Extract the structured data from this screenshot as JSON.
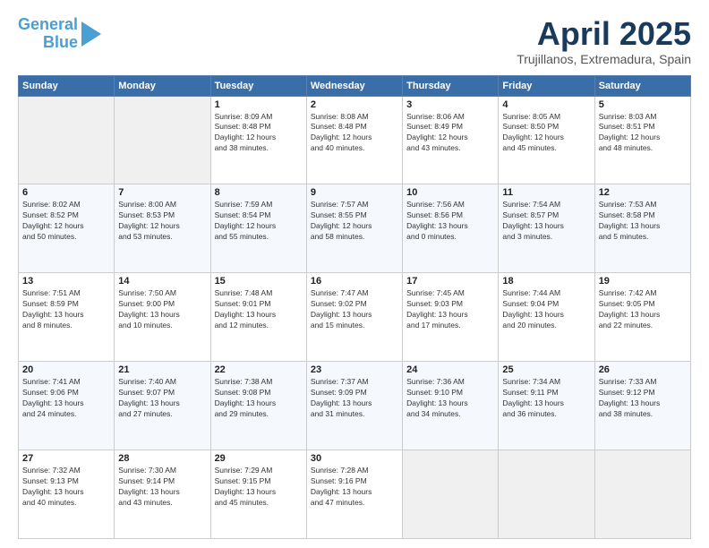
{
  "logo": {
    "line1": "General",
    "line2": "Blue"
  },
  "title": "April 2025",
  "subtitle": "Trujillanos, Extremadura, Spain",
  "weekdays": [
    "Sunday",
    "Monday",
    "Tuesday",
    "Wednesday",
    "Thursday",
    "Friday",
    "Saturday"
  ],
  "weeks": [
    [
      {
        "day": "",
        "info": ""
      },
      {
        "day": "",
        "info": ""
      },
      {
        "day": "1",
        "info": "Sunrise: 8:09 AM\nSunset: 8:48 PM\nDaylight: 12 hours\nand 38 minutes."
      },
      {
        "day": "2",
        "info": "Sunrise: 8:08 AM\nSunset: 8:48 PM\nDaylight: 12 hours\nand 40 minutes."
      },
      {
        "day": "3",
        "info": "Sunrise: 8:06 AM\nSunset: 8:49 PM\nDaylight: 12 hours\nand 43 minutes."
      },
      {
        "day": "4",
        "info": "Sunrise: 8:05 AM\nSunset: 8:50 PM\nDaylight: 12 hours\nand 45 minutes."
      },
      {
        "day": "5",
        "info": "Sunrise: 8:03 AM\nSunset: 8:51 PM\nDaylight: 12 hours\nand 48 minutes."
      }
    ],
    [
      {
        "day": "6",
        "info": "Sunrise: 8:02 AM\nSunset: 8:52 PM\nDaylight: 12 hours\nand 50 minutes."
      },
      {
        "day": "7",
        "info": "Sunrise: 8:00 AM\nSunset: 8:53 PM\nDaylight: 12 hours\nand 53 minutes."
      },
      {
        "day": "8",
        "info": "Sunrise: 7:59 AM\nSunset: 8:54 PM\nDaylight: 12 hours\nand 55 minutes."
      },
      {
        "day": "9",
        "info": "Sunrise: 7:57 AM\nSunset: 8:55 PM\nDaylight: 12 hours\nand 58 minutes."
      },
      {
        "day": "10",
        "info": "Sunrise: 7:56 AM\nSunset: 8:56 PM\nDaylight: 13 hours\nand 0 minutes."
      },
      {
        "day": "11",
        "info": "Sunrise: 7:54 AM\nSunset: 8:57 PM\nDaylight: 13 hours\nand 3 minutes."
      },
      {
        "day": "12",
        "info": "Sunrise: 7:53 AM\nSunset: 8:58 PM\nDaylight: 13 hours\nand 5 minutes."
      }
    ],
    [
      {
        "day": "13",
        "info": "Sunrise: 7:51 AM\nSunset: 8:59 PM\nDaylight: 13 hours\nand 8 minutes."
      },
      {
        "day": "14",
        "info": "Sunrise: 7:50 AM\nSunset: 9:00 PM\nDaylight: 13 hours\nand 10 minutes."
      },
      {
        "day": "15",
        "info": "Sunrise: 7:48 AM\nSunset: 9:01 PM\nDaylight: 13 hours\nand 12 minutes."
      },
      {
        "day": "16",
        "info": "Sunrise: 7:47 AM\nSunset: 9:02 PM\nDaylight: 13 hours\nand 15 minutes."
      },
      {
        "day": "17",
        "info": "Sunrise: 7:45 AM\nSunset: 9:03 PM\nDaylight: 13 hours\nand 17 minutes."
      },
      {
        "day": "18",
        "info": "Sunrise: 7:44 AM\nSunset: 9:04 PM\nDaylight: 13 hours\nand 20 minutes."
      },
      {
        "day": "19",
        "info": "Sunrise: 7:42 AM\nSunset: 9:05 PM\nDaylight: 13 hours\nand 22 minutes."
      }
    ],
    [
      {
        "day": "20",
        "info": "Sunrise: 7:41 AM\nSunset: 9:06 PM\nDaylight: 13 hours\nand 24 minutes."
      },
      {
        "day": "21",
        "info": "Sunrise: 7:40 AM\nSunset: 9:07 PM\nDaylight: 13 hours\nand 27 minutes."
      },
      {
        "day": "22",
        "info": "Sunrise: 7:38 AM\nSunset: 9:08 PM\nDaylight: 13 hours\nand 29 minutes."
      },
      {
        "day": "23",
        "info": "Sunrise: 7:37 AM\nSunset: 9:09 PM\nDaylight: 13 hours\nand 31 minutes."
      },
      {
        "day": "24",
        "info": "Sunrise: 7:36 AM\nSunset: 9:10 PM\nDaylight: 13 hours\nand 34 minutes."
      },
      {
        "day": "25",
        "info": "Sunrise: 7:34 AM\nSunset: 9:11 PM\nDaylight: 13 hours\nand 36 minutes."
      },
      {
        "day": "26",
        "info": "Sunrise: 7:33 AM\nSunset: 9:12 PM\nDaylight: 13 hours\nand 38 minutes."
      }
    ],
    [
      {
        "day": "27",
        "info": "Sunrise: 7:32 AM\nSunset: 9:13 PM\nDaylight: 13 hours\nand 40 minutes."
      },
      {
        "day": "28",
        "info": "Sunrise: 7:30 AM\nSunset: 9:14 PM\nDaylight: 13 hours\nand 43 minutes."
      },
      {
        "day": "29",
        "info": "Sunrise: 7:29 AM\nSunset: 9:15 PM\nDaylight: 13 hours\nand 45 minutes."
      },
      {
        "day": "30",
        "info": "Sunrise: 7:28 AM\nSunset: 9:16 PM\nDaylight: 13 hours\nand 47 minutes."
      },
      {
        "day": "",
        "info": ""
      },
      {
        "day": "",
        "info": ""
      },
      {
        "day": "",
        "info": ""
      }
    ]
  ]
}
